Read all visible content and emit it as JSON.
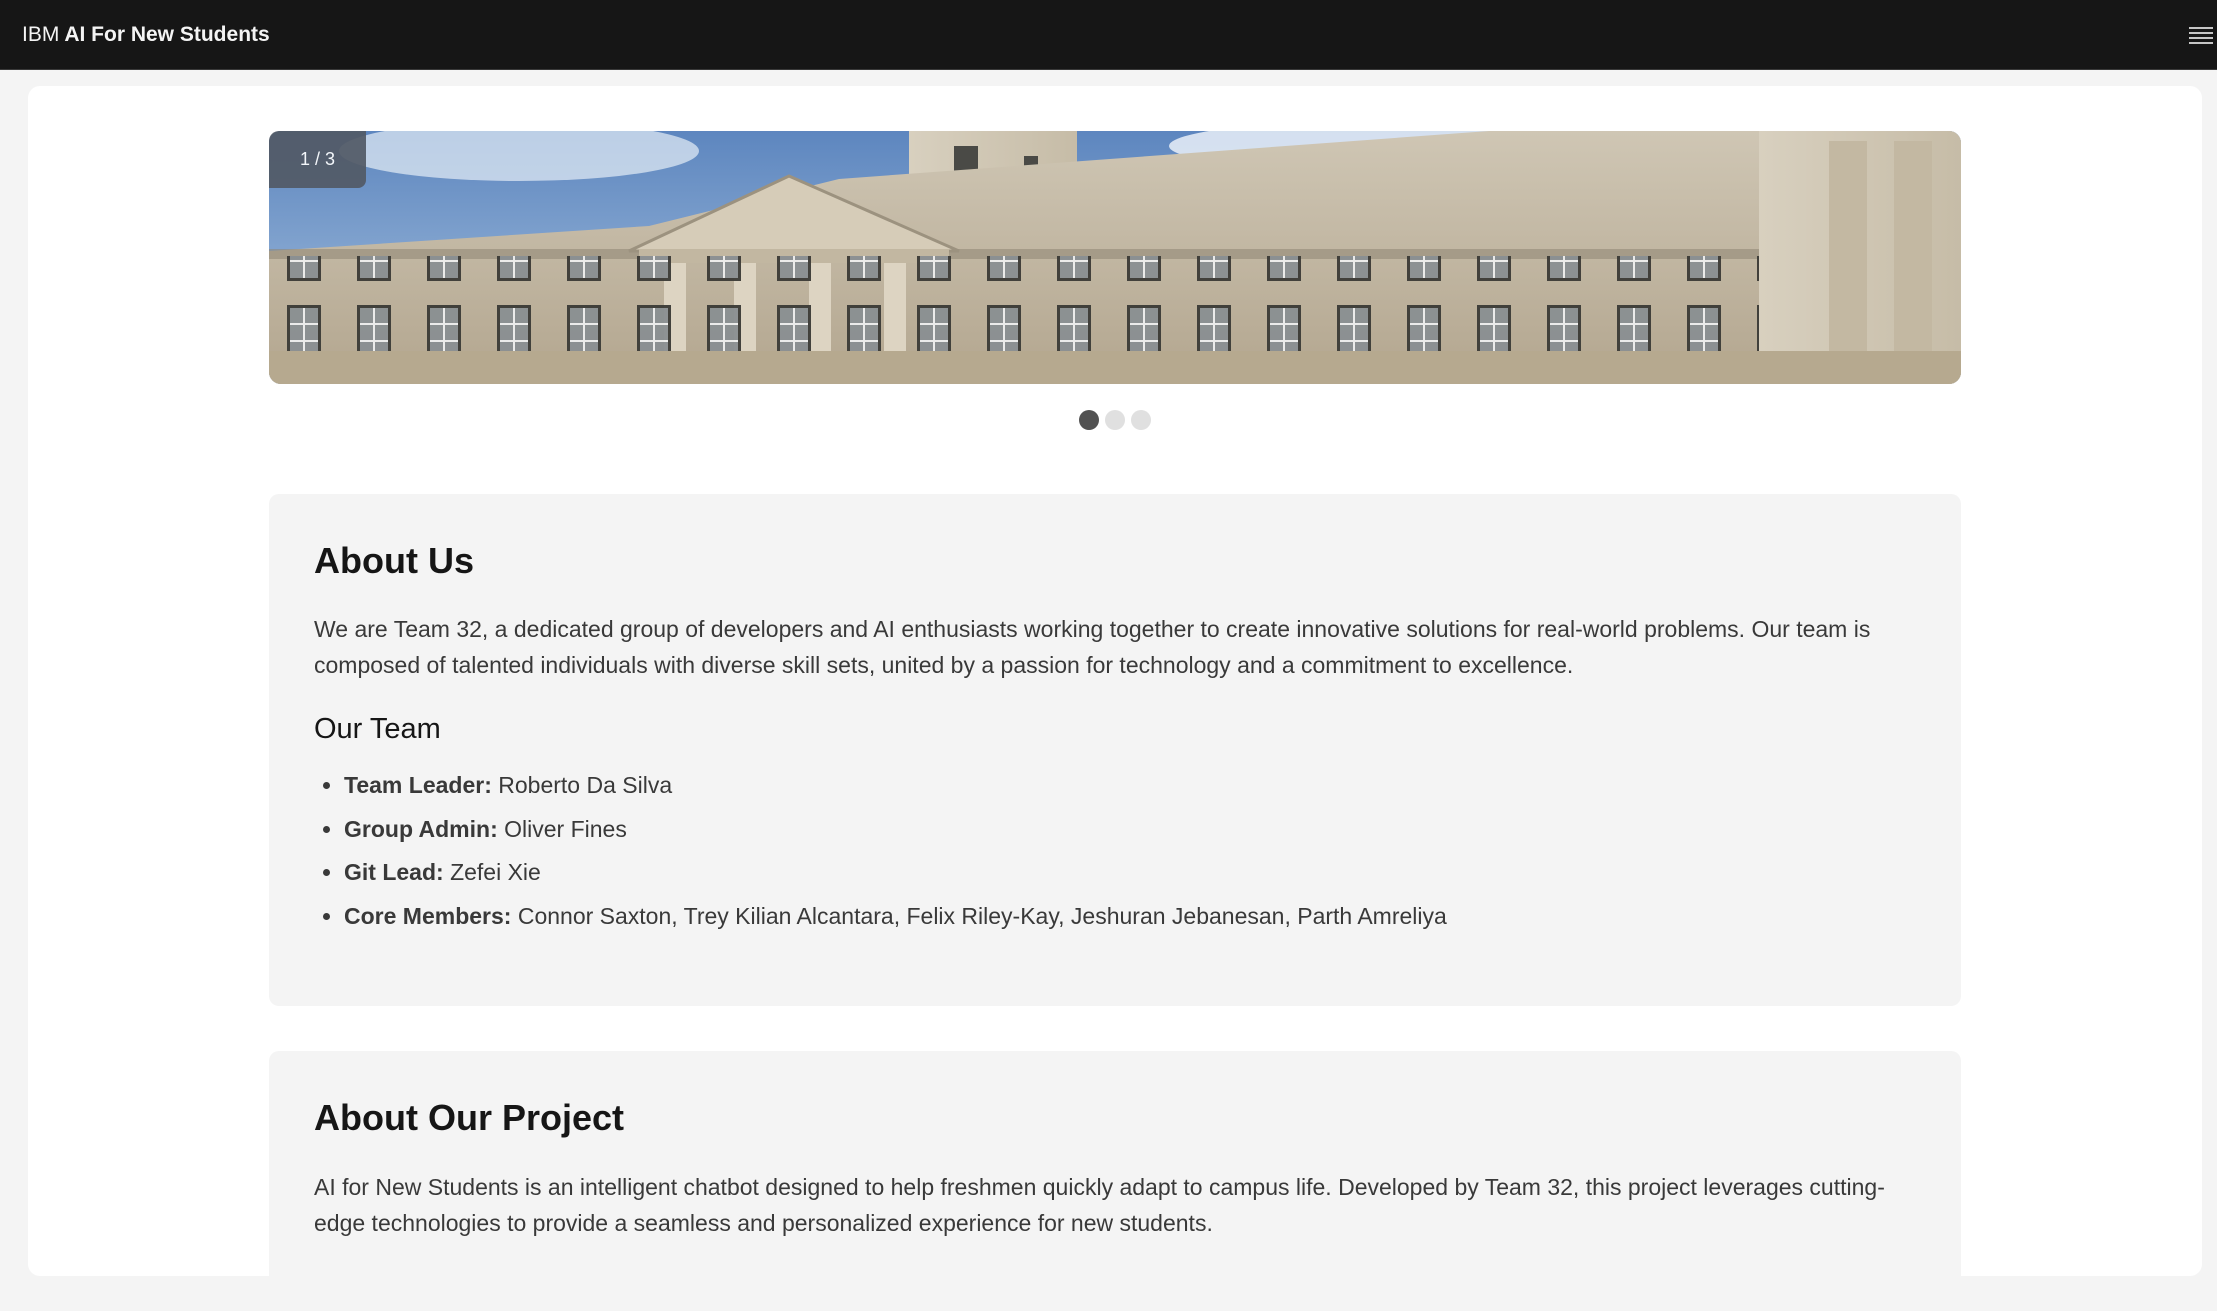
{
  "header": {
    "brand_prefix": "IBM",
    "brand_name": "AI For New Students",
    "menu_icon": "hamburger-menu-icon"
  },
  "carousel": {
    "counter": "1 / 3",
    "current_slide": 1,
    "total_slides": 3,
    "image": "university-building-photo"
  },
  "about": {
    "title": "About Us",
    "description": "We are Team 32, a dedicated group of developers and AI enthusiasts working together to create innovative solutions for real-world problems. Our team is composed of talented individuals with diverse skill sets, united by a passion for technology and a commitment to excellence.",
    "team_heading": "Our Team",
    "members": [
      {
        "role": "Team Leader:",
        "names": "Roberto Da Silva"
      },
      {
        "role": "Group Admin:",
        "names": "Oliver Fines"
      },
      {
        "role": "Git Lead:",
        "names": "Zefei Xie"
      },
      {
        "role": "Core Members:",
        "names": "Connor Saxton, Trey Kilian Alcantara, Felix Riley-Kay, Jeshuran Jebanesan, Parth Amreliya"
      }
    ]
  },
  "project": {
    "title": "About Our Project",
    "description": "AI for New Students is an intelligent chatbot designed to help freshmen quickly adapt to campus life. Developed by Team 32, this project leverages cutting-edge technologies to provide a seamless and personalized experience for new students."
  },
  "colors": {
    "header_bg": "#161616",
    "page_bg": "#f4f4f4",
    "card_bg": "#f4f4f4",
    "dot_active": "#525252",
    "dot_inactive": "#e0e0e0"
  }
}
